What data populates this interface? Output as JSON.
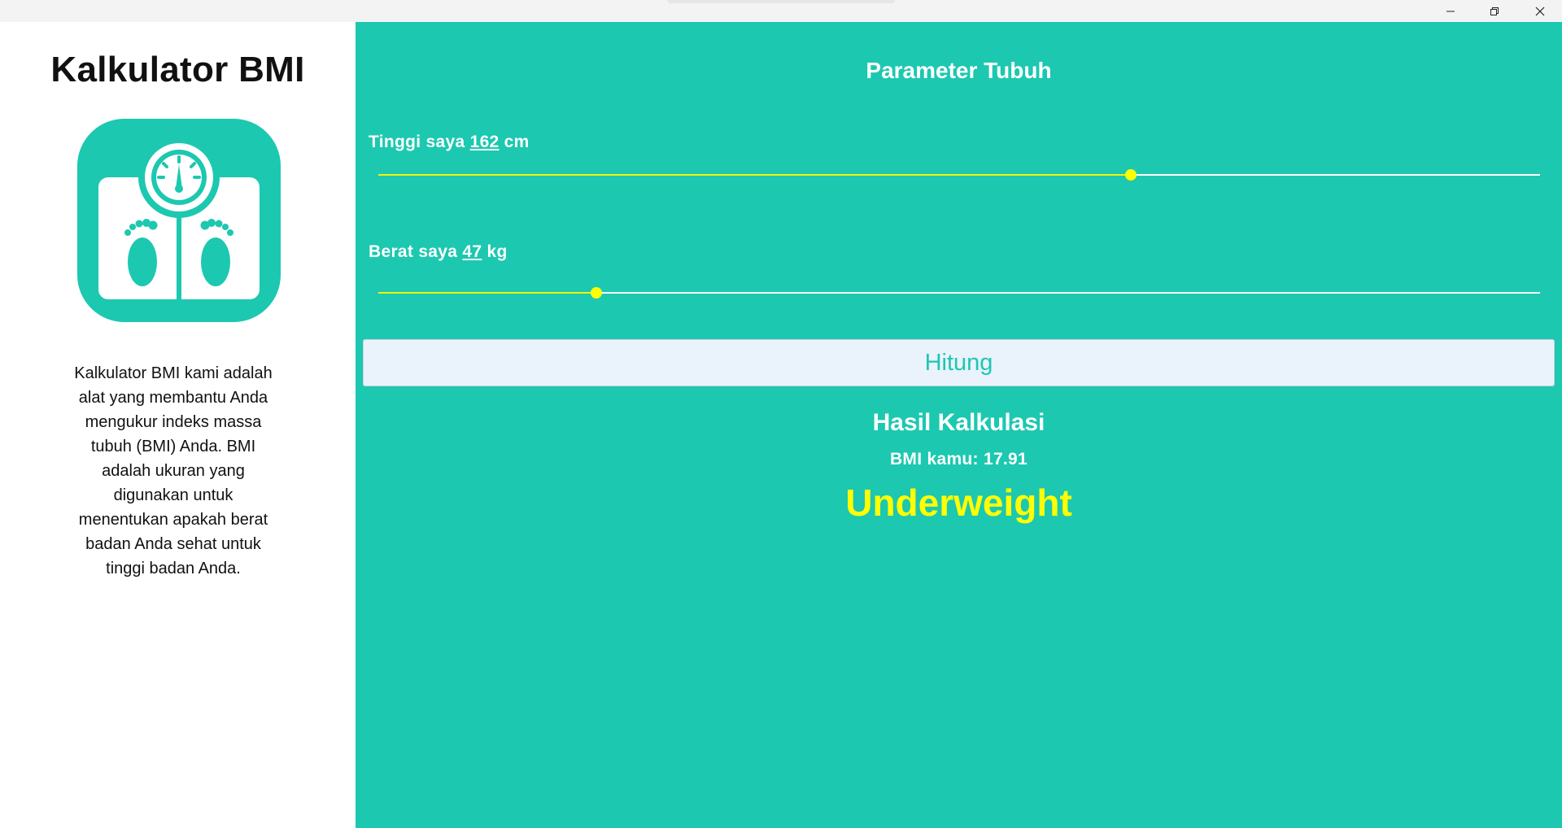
{
  "colors": {
    "main_background": "#1cc8b0",
    "accent_yellow": "#ffff00",
    "button_background": "#eaf2fb"
  },
  "window_controls": {
    "minimize_icon": "minimize-icon",
    "maximize_icon": "restore-icon",
    "close_icon": "close-icon"
  },
  "sidebar": {
    "title": "Kalkulator BMI",
    "logo_icon": "bathroom-scale-icon",
    "description": "Kalkulator BMI kami adalah alat yang membantu Anda mengukur indeks massa tubuh (BMI) Anda. BMI adalah ukuran yang digunakan untuk menentukan apakah berat badan Anda sehat untuk tinggi badan Anda."
  },
  "main": {
    "section_title": "Parameter Tubuh",
    "height": {
      "prefix": "Tinggi saya ",
      "value": "162",
      "unit": " cm",
      "slider_fraction": 0.648
    },
    "weight": {
      "prefix": "Berat saya ",
      "value": "47",
      "unit": " kg",
      "slider_fraction": 0.188
    },
    "calculate_button": "Hitung",
    "result_title": "Hasil Kalkulasi",
    "bmi_label": "BMI kamu: ",
    "bmi_value": "17.91",
    "category": "Underweight"
  }
}
